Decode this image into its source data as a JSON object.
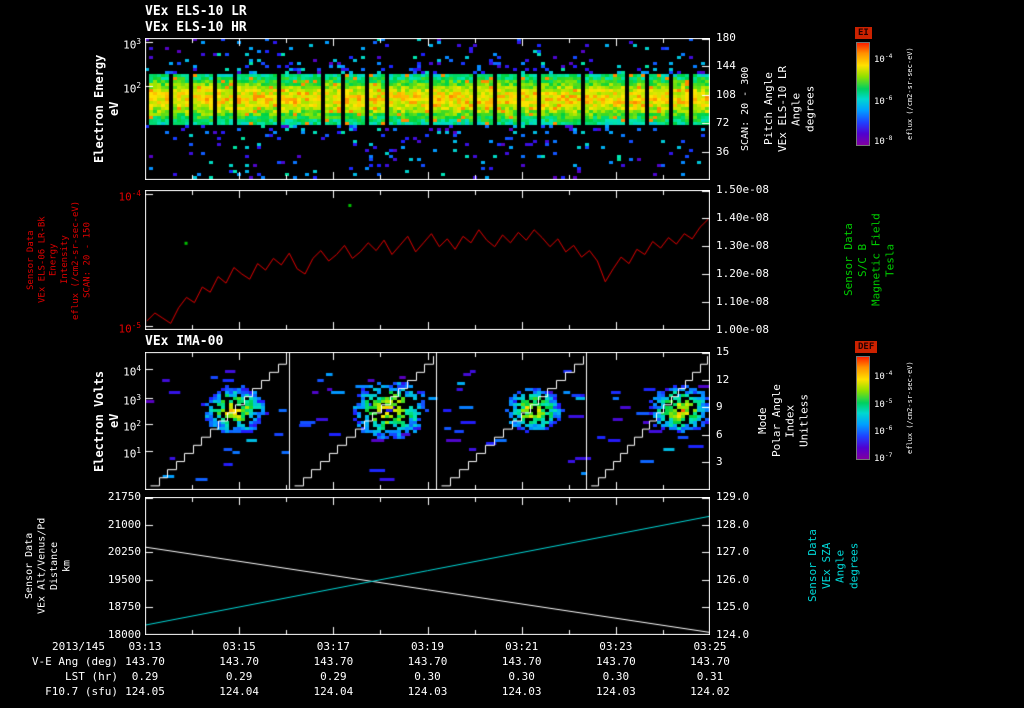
{
  "meta": {
    "background": "#000000"
  },
  "colors": {
    "axis": "#ffffff",
    "panel2_trace": "#e00000",
    "panel2_left_label": "#e00000",
    "panel2_right_label": "#00cc00",
    "panel4_alt_line": "#ffffff",
    "panel4_sza_line": "#00d8d8",
    "colorbar_title_bg": "#cc2200"
  },
  "chart_data": [
    {
      "id": "els_spectrogram",
      "type": "heatmap",
      "titles": [
        "VEx ELS-10 LR",
        "VEx ELS-10 HR"
      ],
      "left_label_lines": [
        "Electron Energy",
        "eV"
      ],
      "left_ticks": [
        {
          "label": "10^3",
          "frac": 0.03
        },
        {
          "label": "10^2",
          "frac": 0.34
        }
      ],
      "right_ticks": [
        {
          "label": "180",
          "frac": 0
        },
        {
          "label": "144",
          "frac": 0.2
        },
        {
          "label": "108",
          "frac": 0.4
        },
        {
          "label": "72",
          "frac": 0.6
        },
        {
          "label": "36",
          "frac": 0.8
        }
      ],
      "right_scan_label": "SCAN: 20 - 300",
      "right_label_lines": [
        "Pitch Angle",
        "VEx ELS-10 LR",
        "Angle",
        "degrees"
      ],
      "colorbar": {
        "title": "EI",
        "units": "eflux (/cm2-sr-sec-eV)",
        "ticks": [
          {
            "label": "10^-4",
            "frac": 0.14
          },
          {
            "label": "10^-6",
            "frac": 0.55
          },
          {
            "label": "10^-8",
            "frac": 0.93
          }
        ]
      },
      "band": {
        "center_frac": 0.42,
        "half_frac": 0.1,
        "segments": 26
      },
      "x_range": [
        "03:13",
        "03:25"
      ],
      "description": "Electron energy-time spectrogram; continuous bright yellow-green band (~30-300 eV) across all times with scattered blue/cyan counts above and below, periodic black scan gaps"
    },
    {
      "id": "els06_intensity",
      "type": "line",
      "left_label_lines": [
        "Sensor Data",
        "VEx ELS-06 LR-Bk",
        "Energy",
        "Intensity",
        "eflux (/cm2-sr-sec-eV)",
        "SCAN: 20 - 150"
      ],
      "left_tick_color": "#e00000",
      "left_ticks": [
        {
          "label": "10^-4",
          "frac": 0.03
        },
        {
          "label": "10^-5",
          "frac": 0.97
        }
      ],
      "right_ticks": [
        {
          "label": "1.50e-08",
          "frac": 0
        },
        {
          "label": "1.40e-08",
          "frac": 0.2
        },
        {
          "label": "1.30e-08",
          "frac": 0.4
        },
        {
          "label": "1.20e-08",
          "frac": 0.6
        },
        {
          "label": "1.10e-08",
          "frac": 0.8
        },
        {
          "label": "1.00e-08",
          "frac": 1
        }
      ],
      "right_label_lines": [
        "Sensor Data",
        "S/C B",
        "Magnetic Field",
        "Tesla"
      ],
      "ylim_left": [
        "1e-5",
        "1e-4"
      ],
      "ylim_right": [
        "1.00e-08",
        "1.50e-08"
      ],
      "series": [
        {
          "name": "ELS-06 LR-Bk eflux",
          "color": "#e00000",
          "y_norm": [
            0.04,
            0.1,
            0.06,
            0.02,
            0.14,
            0.22,
            0.18,
            0.3,
            0.26,
            0.38,
            0.33,
            0.45,
            0.4,
            0.36,
            0.48,
            0.43,
            0.52,
            0.47,
            0.56,
            0.44,
            0.4,
            0.52,
            0.58,
            0.5,
            0.55,
            0.62,
            0.52,
            0.57,
            0.64,
            0.58,
            0.66,
            0.55,
            0.62,
            0.69,
            0.57,
            0.64,
            0.71,
            0.61,
            0.67,
            0.59,
            0.69,
            0.64,
            0.74,
            0.66,
            0.61,
            0.7,
            0.64,
            0.72,
            0.66,
            0.74,
            0.68,
            0.61,
            0.67,
            0.57,
            0.62,
            0.53,
            0.58,
            0.5,
            0.34,
            0.44,
            0.53,
            0.48,
            0.59,
            0.55,
            0.65,
            0.6,
            0.68,
            0.63,
            0.71,
            0.67,
            0.76,
            0.82
          ]
        }
      ],
      "specks": [
        {
          "x": 0.07,
          "y": 0.37
        },
        {
          "x": 0.36,
          "y": 0.1
        }
      ]
    },
    {
      "id": "ima_spectrogram",
      "type": "heatmap",
      "title": "VEx IMA-00",
      "left_label_lines": [
        "Electron Volts",
        "eV"
      ],
      "left_ticks": [
        {
          "label": "10^4",
          "frac": 0.12
        },
        {
          "label": "10^3",
          "frac": 0.33
        },
        {
          "label": "10^2",
          "frac": 0.52
        },
        {
          "label": "10^1",
          "frac": 0.72
        }
      ],
      "right_ticks": [
        {
          "label": "15",
          "frac": 0
        },
        {
          "label": "12",
          "frac": 0.2
        },
        {
          "label": "9",
          "frac": 0.4
        },
        {
          "label": "6",
          "frac": 0.6
        },
        {
          "label": "3",
          "frac": 0.8
        }
      ],
      "right_label_lines": [
        "Mode",
        "Polar Angle",
        "Index",
        "Unitless"
      ],
      "colorbar": {
        "title": "DEF",
        "units": "eflux (/cm2-sr-sec-eV)",
        "ticks": [
          {
            "label": "10^-4",
            "frac": 0.17
          },
          {
            "label": "10^-5",
            "frac": 0.44
          },
          {
            "label": "10^-6",
            "frac": 0.7
          },
          {
            "label": "10^-7",
            "frac": 0.96
          }
        ]
      },
      "blobs": {
        "x_fracs": [
          0.155,
          0.43,
          0.685,
          0.945
        ],
        "size_fracs": [
          1.0,
          1.25,
          0.9,
          1.0
        ],
        "y_frac": 0.41
      },
      "mode_dividers_frac": [
        0.255,
        0.515,
        0.78
      ],
      "staircase_steps": 16,
      "description": "Ion energy spectrogram: four periodic green/yellow ion populations near 100-1000 eV, scattered blue dashes, white staircase energy-sweep / polar-angle-index ramps repeating four times"
    },
    {
      "id": "ephemeris",
      "type": "line",
      "left_label_lines": [
        "Sensor Data",
        "VEx Alt/Venus/Pd",
        "Distance",
        "km"
      ],
      "left_ticks": [
        {
          "label": "21750",
          "frac": 0
        },
        {
          "label": "21000",
          "frac": 0.2
        },
        {
          "label": "20250",
          "frac": 0.4
        },
        {
          "label": "19500",
          "frac": 0.6
        },
        {
          "label": "18750",
          "frac": 0.8
        },
        {
          "label": "18000",
          "frac": 1
        }
      ],
      "right_ticks": [
        {
          "label": "129.0",
          "frac": 0
        },
        {
          "label": "128.0",
          "frac": 0.2
        },
        {
          "label": "127.0",
          "frac": 0.4
        },
        {
          "label": "126.0",
          "frac": 0.6
        },
        {
          "label": "125.0",
          "frac": 0.8
        },
        {
          "label": "124.0",
          "frac": 1
        }
      ],
      "right_label_lines": [
        "Sensor Data",
        "VEx SZA",
        "Angle",
        "degrees"
      ],
      "right_label_color": "#00d8d8",
      "series": [
        {
          "name": "VEx altitude (km)",
          "color": "#ffffff",
          "axis": "left",
          "range": [
            18000,
            21750
          ],
          "x_frac": [
            0,
            1
          ],
          "values": [
            20400,
            18020
          ]
        },
        {
          "name": "VEx SZA (deg)",
          "color": "#00d8d8",
          "axis": "right",
          "range": [
            124,
            129
          ],
          "x_frac": [
            0,
            1
          ],
          "values": [
            124.3,
            128.35
          ]
        }
      ]
    }
  ],
  "bottom_axis": {
    "date": "2013/145",
    "time_ticks": [
      "03:13",
      "03:15",
      "03:17",
      "03:19",
      "03:21",
      "03:23",
      "03:25"
    ],
    "rows": [
      {
        "label": "V-E Ang (deg)",
        "values": [
          "143.70",
          "143.70",
          "143.70",
          "143.70",
          "143.70",
          "143.70",
          "143.70"
        ]
      },
      {
        "label": "LST (hr)",
        "values": [
          "0.29",
          "0.29",
          "0.29",
          "0.30",
          "0.30",
          "0.30",
          "0.31"
        ]
      },
      {
        "label": "F10.7 (sfu)",
        "values": [
          "124.05",
          "124.04",
          "124.04",
          "124.03",
          "124.03",
          "124.03",
          "124.02"
        ]
      }
    ]
  }
}
